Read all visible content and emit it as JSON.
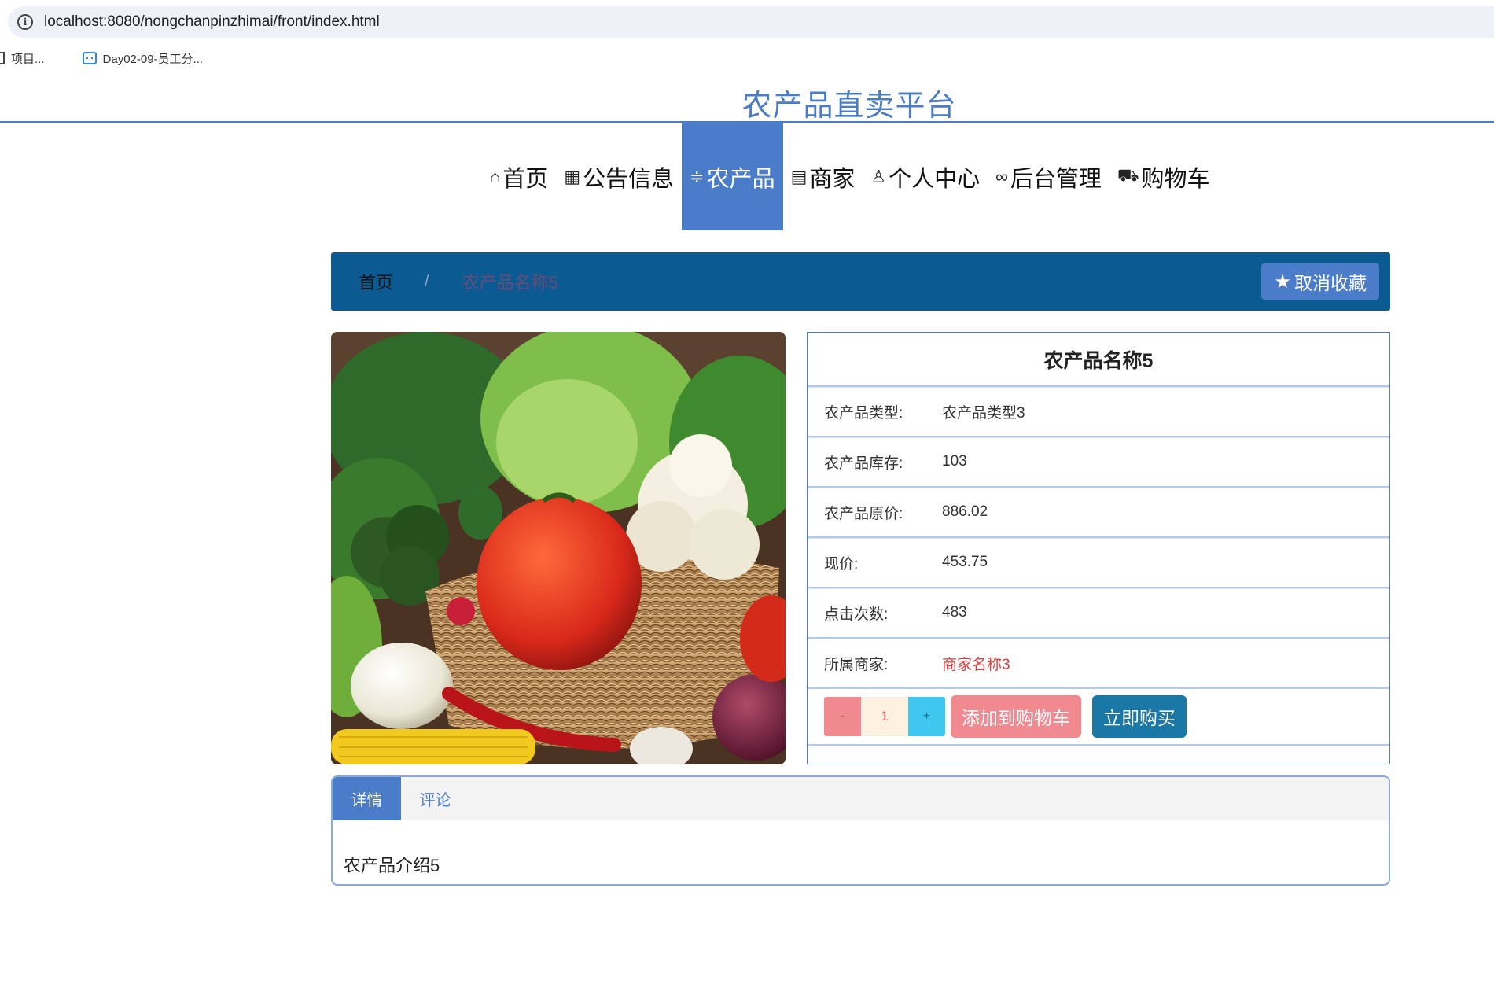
{
  "browser": {
    "url": "localhost:8080/nongchanpinzhimai/front/index.html",
    "bookmarks": [
      {
        "label": "项目..."
      },
      {
        "label": "Day02-09-员工分..."
      }
    ]
  },
  "site": {
    "title": "农产品直卖平台"
  },
  "nav": {
    "items": [
      {
        "label": "首页",
        "icon": "home-icon",
        "glyph": "⌂"
      },
      {
        "label": "公告信息",
        "icon": "grid-icon",
        "glyph": "▦"
      },
      {
        "label": "农产品",
        "icon": "sliders-icon",
        "glyph": "≑"
      },
      {
        "label": "商家",
        "icon": "clipboard-icon",
        "glyph": "▤"
      },
      {
        "label": "个人中心",
        "icon": "user-icon",
        "glyph": "♙"
      },
      {
        "label": "后台管理",
        "icon": "link-icon",
        "glyph": "∞"
      },
      {
        "label": "购物车",
        "icon": "cart-icon",
        "glyph": "⛟"
      }
    ],
    "active": "农产品"
  },
  "breadcrumb": {
    "home": "首页",
    "separator": "/",
    "current": "农产品名称5",
    "favorite_button": "取消收藏"
  },
  "product": {
    "name": "农产品名称5",
    "fields": [
      {
        "label": "农产品类型:",
        "value": "农产品类型3"
      },
      {
        "label": "农产品库存:",
        "value": "103"
      },
      {
        "label": "农产品原价:",
        "value": "886.02"
      },
      {
        "label": "现价:",
        "value": "453.75"
      },
      {
        "label": "点击次数:",
        "value": "483"
      },
      {
        "label": "所属商家:",
        "value": "商家名称3"
      }
    ],
    "quantity": "1",
    "minus_label": "-",
    "plus_label": "+",
    "add_to_cart": "添加到购物车",
    "buy_now": "立即购买"
  },
  "tabs": {
    "items": [
      {
        "label": "详情"
      },
      {
        "label": "评论"
      }
    ],
    "active": "详情",
    "content": "农产品介绍5"
  },
  "colors": {
    "primary": "#4a7cc9",
    "breadcrumb_bg": "#0b5a92",
    "minus_bg": "#f08a90",
    "plus_bg": "#3fc7ef",
    "buy_bg": "#1a78a6",
    "merchant_link": "#e23b3b"
  }
}
